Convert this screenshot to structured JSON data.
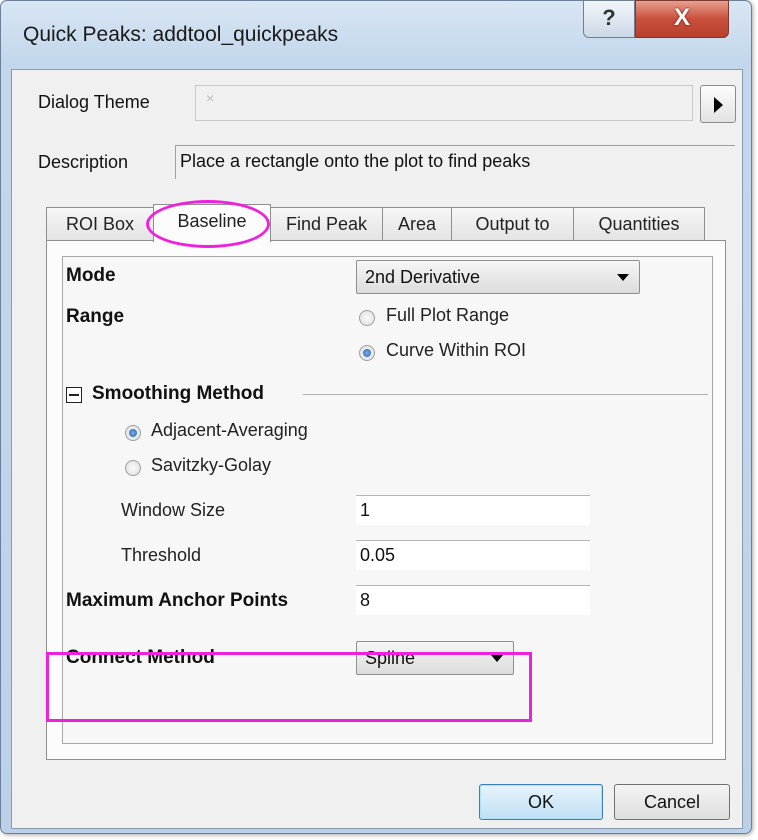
{
  "window": {
    "title": "Quick Peaks: addtool_quickpeaks",
    "help_glyph": "?",
    "close_glyph": "X"
  },
  "dialog_theme": {
    "label": "Dialog Theme",
    "value": "×",
    "arrow_icon": "triangle-right-icon"
  },
  "description": {
    "label": "Description",
    "text": "Place a rectangle onto the plot to find peaks"
  },
  "tabs": [
    {
      "label": "ROI Box",
      "active": false
    },
    {
      "label": "Baseline",
      "active": true
    },
    {
      "label": "Find Peak",
      "active": false
    },
    {
      "label": "Area",
      "active": false
    },
    {
      "label": "Output to",
      "active": false
    },
    {
      "label": "Quantities",
      "active": false
    }
  ],
  "baseline": {
    "mode_label": "Mode",
    "mode_value": "2nd Derivative",
    "range_label": "Range",
    "range_options": [
      {
        "label": "Full Plot Range",
        "checked": false
      },
      {
        "label": "Curve Within ROI",
        "checked": true
      }
    ],
    "smoothing": {
      "group_label": "Smoothing Method",
      "options": [
        {
          "label": "Adjacent-Averaging",
          "checked": true
        },
        {
          "label": "Savitzky-Golay",
          "checked": false
        }
      ],
      "window_size_label": "Window Size",
      "window_size_value": "1",
      "threshold_label": "Threshold",
      "threshold_value": "0.05"
    },
    "max_anchor_label": "Maximum Anchor Points",
    "max_anchor_value": "8",
    "connect_label": "Connect Method",
    "connect_value": "Spline"
  },
  "buttons": {
    "ok": "OK",
    "cancel": "Cancel"
  },
  "colors": {
    "highlight": "#ee22dd",
    "title_bar": "#c3d7ec"
  }
}
